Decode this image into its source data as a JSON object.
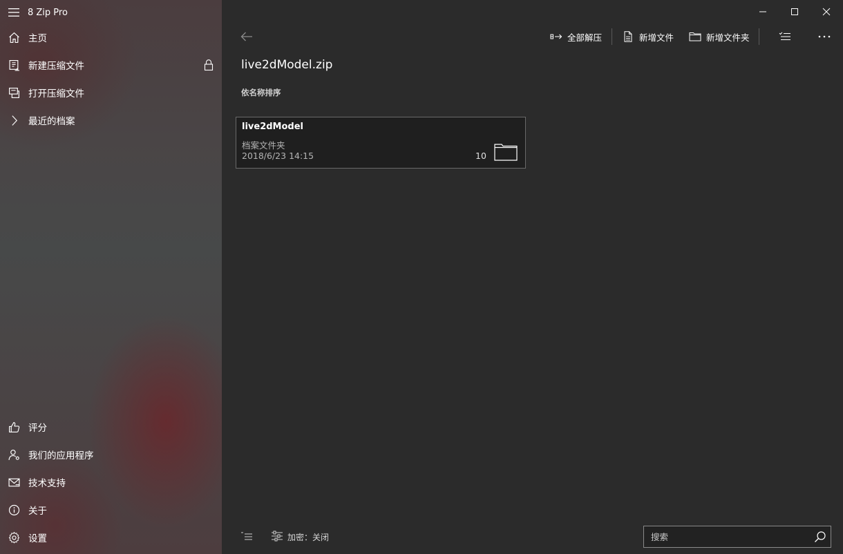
{
  "app": {
    "title": "8 Zip Pro"
  },
  "sidebar": {
    "items": [
      {
        "label": "主页",
        "icon": "home-icon"
      },
      {
        "label": "新建压缩文件",
        "icon": "new-archive-icon",
        "locked": true
      },
      {
        "label": "打开压缩文件",
        "icon": "open-archive-icon"
      },
      {
        "label": "最近的档案",
        "icon": "chevron-right-icon"
      }
    ],
    "bottom_items": [
      {
        "label": "评分",
        "icon": "thumbs-up-icon"
      },
      {
        "label": "我们的应用程序",
        "icon": "person-apps-icon"
      },
      {
        "label": "技术支持",
        "icon": "mail-icon"
      },
      {
        "label": "关于",
        "icon": "info-icon"
      },
      {
        "label": "设置",
        "icon": "gear-icon"
      }
    ]
  },
  "toolbar": {
    "extract_all": "全部解压",
    "new_file": "新增文件",
    "new_folder": "新增文件夹"
  },
  "archive": {
    "title": "live2dModel.zip",
    "sort_label": "依名称排序"
  },
  "items": [
    {
      "name": "live2dModel",
      "type": "档案文件夹",
      "date": "2018/6/23 14:15",
      "count": "10"
    }
  ],
  "footer": {
    "encryption": "加密：关闭",
    "search_placeholder": "搜索"
  },
  "colors": {
    "background": "#2b2b2b",
    "tile_background": "#1f1f1f",
    "text": "#ffffff"
  }
}
